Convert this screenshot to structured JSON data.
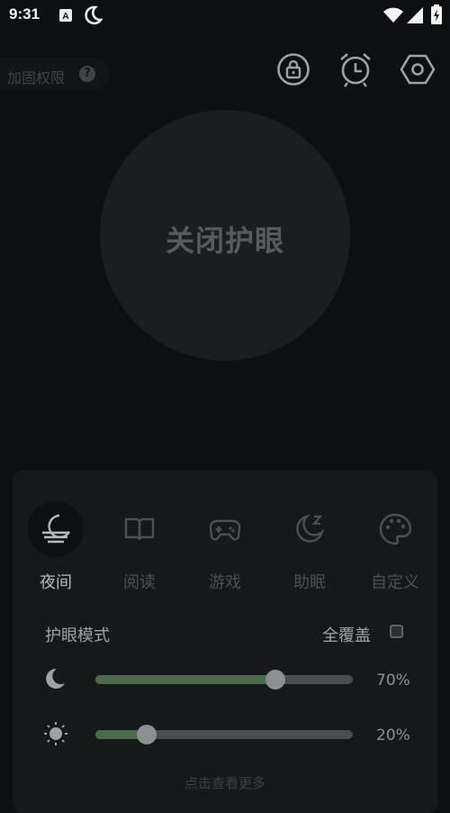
{
  "status_bar": {
    "time": "9:31",
    "left_icons": [
      "font-a-icon",
      "night-moon-icon"
    ],
    "right_icons": [
      "wifi-icon",
      "signal-icon",
      "battery-charging-icon"
    ]
  },
  "header": {
    "permission_label": "加固权限",
    "help_symbol": "?",
    "icons": [
      "lock-icon",
      "alarm-clock-icon",
      "settings-hexagon-icon"
    ]
  },
  "main": {
    "toggle_label": "关闭护眼"
  },
  "panel": {
    "modes": [
      {
        "label": "夜间",
        "icon": "night-moon-icon",
        "active": true
      },
      {
        "label": "阅读",
        "icon": "book-icon",
        "active": false
      },
      {
        "label": "游戏",
        "icon": "gamepad-icon",
        "active": false
      },
      {
        "label": "助眠",
        "icon": "sleep-moon-icon",
        "active": false
      },
      {
        "label": "自定义",
        "icon": "palette-icon",
        "active": false
      }
    ],
    "section_title": "护眼模式",
    "full_cover_label": "全覆盖",
    "full_cover_checked": false,
    "sliders": [
      {
        "icon": "moon-icon",
        "value": 0.7,
        "value_label": "70%"
      },
      {
        "icon": "sun-icon",
        "value": 0.2,
        "value_label": "20%"
      }
    ],
    "more_link": "点击查看更多"
  },
  "colors": {
    "background": "#0d1011",
    "panel": "#16191a",
    "accent_green": "#4c6b4b",
    "circle": "#1b1e20"
  }
}
